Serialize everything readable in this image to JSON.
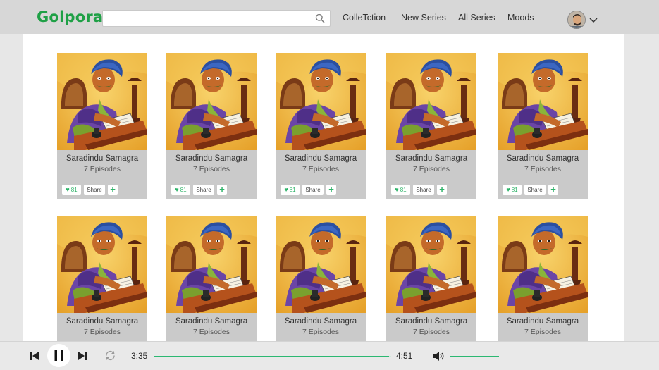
{
  "app": {
    "logo": "Golpora"
  },
  "search": {
    "placeholder": "",
    "icon": "search-icon"
  },
  "nav": [
    "ColleTction",
    "New Series",
    "All Series",
    "Moods"
  ],
  "profile": {
    "icon": "avatar",
    "menu_icon": "chevron-down-icon"
  },
  "cards": [
    {
      "title": "Saradindu Samagra",
      "episodes": "7 Episodes",
      "likes": "81",
      "share": "Share"
    },
    {
      "title": "Saradindu Samagra",
      "episodes": "7 Episodes",
      "likes": "81",
      "share": "Share"
    },
    {
      "title": "Saradindu Samagra",
      "episodes": "7 Episodes",
      "likes": "81",
      "share": "Share"
    },
    {
      "title": "Saradindu Samagra",
      "episodes": "7 Episodes",
      "likes": "81",
      "share": "Share"
    },
    {
      "title": "Saradindu Samagra",
      "episodes": "7 Episodes",
      "likes": "81",
      "share": "Share"
    },
    {
      "title": "Saradindu Samagra",
      "episodes": "7 Episodes"
    },
    {
      "title": "Saradindu Samagra",
      "episodes": "7 Episodes"
    },
    {
      "title": "Saradindu Samagra",
      "episodes": "7 Episodes"
    },
    {
      "title": "Saradindu Samagra",
      "episodes": "7 Episodes"
    },
    {
      "title": "Saradindu Samagra",
      "episodes": "7 Episodes"
    }
  ],
  "player": {
    "current_time": "3:35",
    "total_time": "4:51",
    "progress": 0.99,
    "volume": 1.0
  },
  "colors": {
    "brand": "#1fa046",
    "accent": "#2cb872",
    "header": "#d7d7d7"
  }
}
